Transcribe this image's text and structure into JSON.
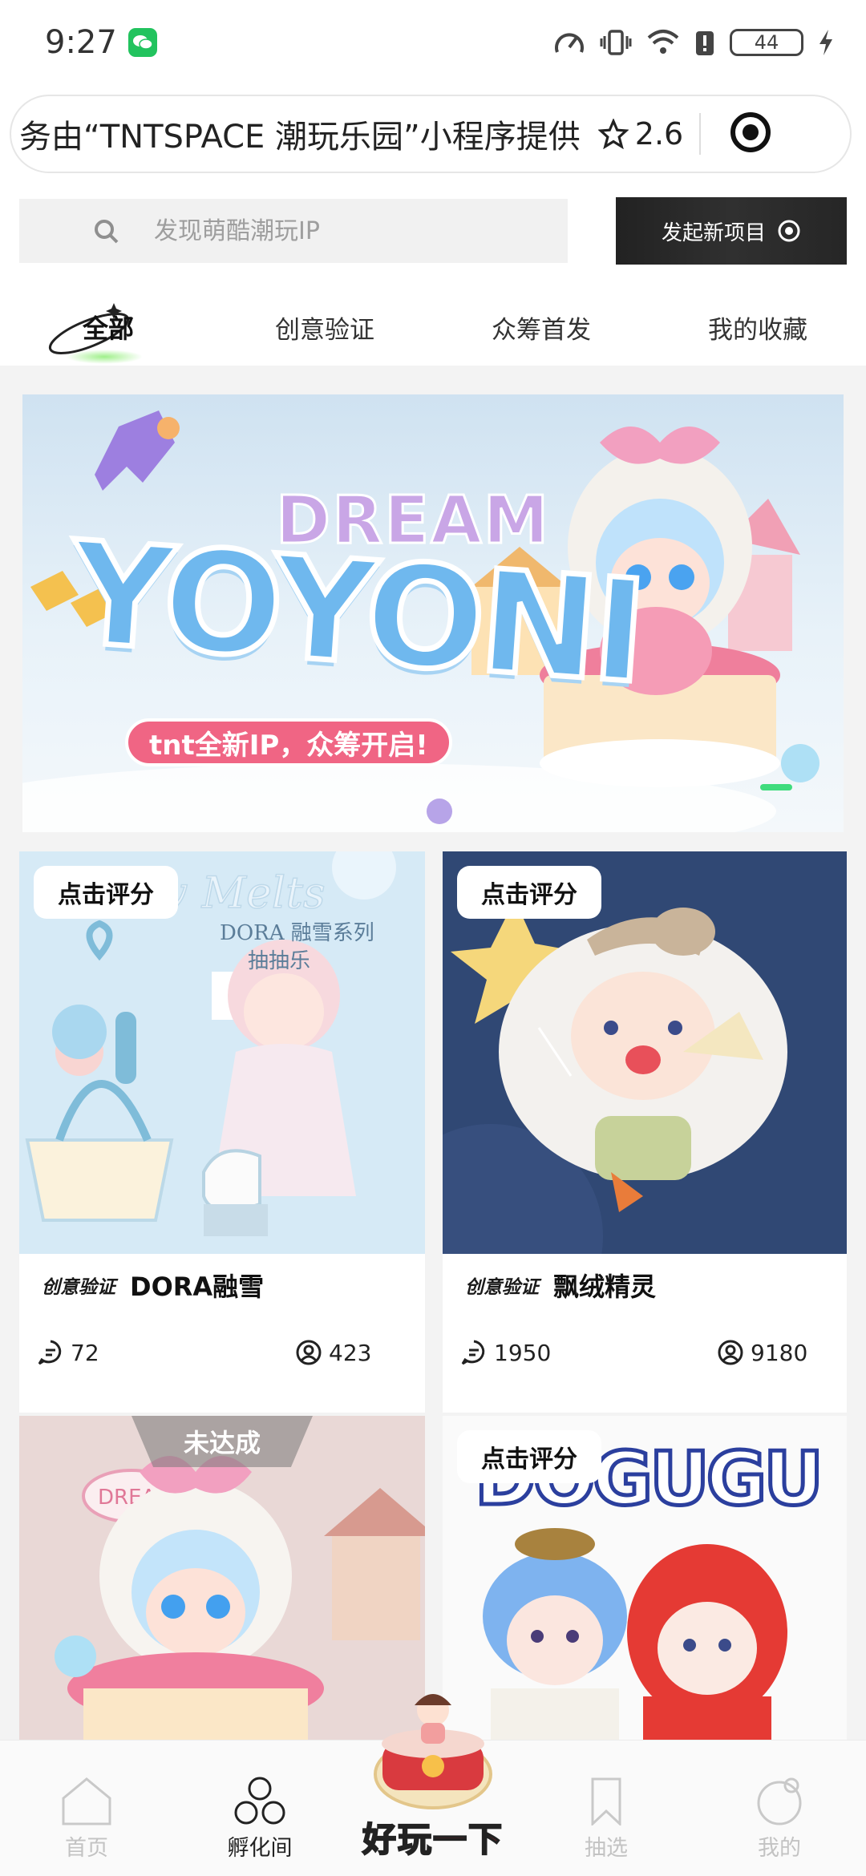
{
  "status_bar": {
    "time": "9:27",
    "battery": "44"
  },
  "capsule": {
    "text": "务由“TNTSPACE 潮玩乐园”小程序提供",
    "rating": "2.6"
  },
  "search": {
    "placeholder": "发现萌酷潮玩IP"
  },
  "new_project_button": {
    "label": "发起新项目"
  },
  "tabs": [
    {
      "label": "全部",
      "active": true
    },
    {
      "label": "创意验证",
      "active": false
    },
    {
      "label": "众筹首发",
      "active": false
    },
    {
      "label": "我的收藏",
      "active": false
    }
  ],
  "banner": {
    "small_title": "DREAM",
    "title": "YOYONI",
    "pill": "tnt全新IP，众筹开启!"
  },
  "cards": [
    {
      "tag": "点击评分",
      "badge": "创意验证",
      "title": "DORA融雪",
      "comments": "72",
      "participants": "423",
      "art_caption": "DORA 融雪系列 抽抽乐"
    },
    {
      "tag": "点击评分",
      "badge": "创意验证",
      "title": "飘绒精灵",
      "comments": "1950",
      "participants": "9180"
    },
    {
      "status": "未达成",
      "art_caption": "DREAM"
    },
    {
      "tag": "点击评分",
      "art_caption": "DOGUGU"
    }
  ],
  "bottom_nav": [
    {
      "label": "首页",
      "icon": "home-icon",
      "active": false
    },
    {
      "label": "孵化间",
      "icon": "incubator-icon",
      "active": true
    },
    {
      "label": "好玩一下",
      "icon": "blind-box-icon",
      "active": false
    },
    {
      "label": "抽选",
      "icon": "bookmark-icon",
      "active": false
    },
    {
      "label": "我的",
      "icon": "profile-icon",
      "active": false
    }
  ],
  "colors": {
    "accent_green": "#69e26b",
    "dark_button": "#262626",
    "feed_background": "#f3f3f3",
    "banner_pill": "#f06584",
    "nav_center_red": "#d81f2a"
  }
}
